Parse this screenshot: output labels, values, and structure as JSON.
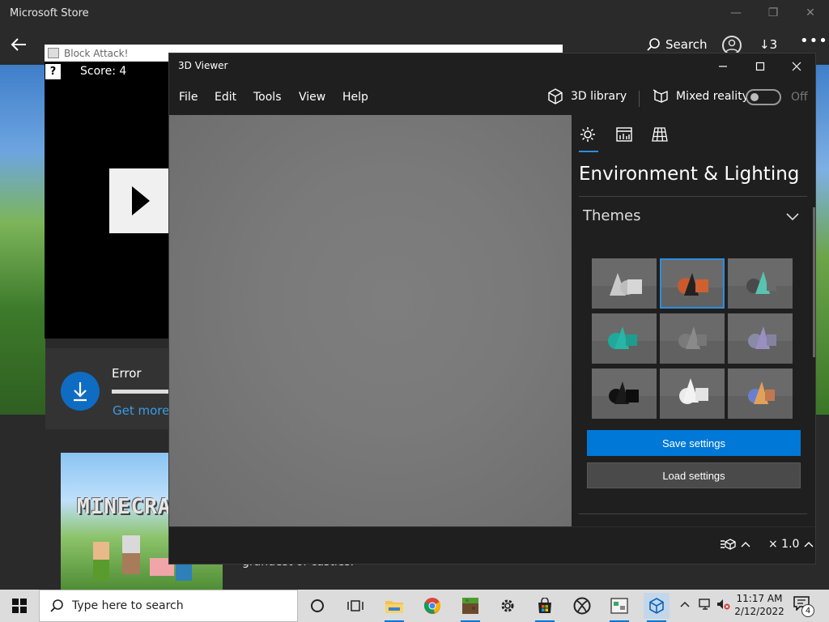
{
  "store": {
    "title": "Microsoft Store",
    "window_controls": [
      "—",
      "❐",
      "✕"
    ],
    "search_label": "Search",
    "downloads_count": "3",
    "error_title": "Error",
    "error_link": "Get more",
    "poster_text": "MINECRA",
    "description_snippet": "grandest of castles."
  },
  "block_attack": {
    "title": "Block Attack!",
    "help_label": "?",
    "score": "Score: 4"
  },
  "viewer": {
    "title": "3D Viewer",
    "menu": [
      "File",
      "Edit",
      "Tools",
      "View",
      "Help"
    ],
    "library_label": "3D library",
    "mixed_reality_label": "Mixed reality",
    "mixed_reality_state": "Off",
    "panel": {
      "heading": "Environment & Lighting",
      "themes_label": "Themes",
      "save_label": "Save settings",
      "load_label": "Load settings",
      "selected_theme_index": 1
    },
    "zoom": "× 1.0"
  },
  "taskbar": {
    "search_placeholder": "Type here to search",
    "time": "11:17 AM",
    "date": "2/12/2022",
    "notification_count": "4"
  },
  "colors": {
    "accent": "#0078d7",
    "link": "#3a9be6"
  }
}
